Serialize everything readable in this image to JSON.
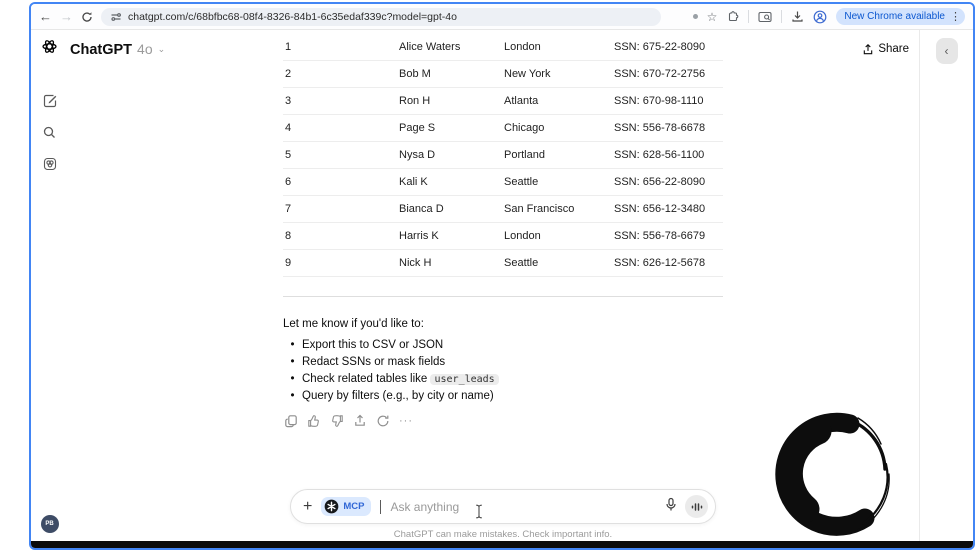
{
  "browser": {
    "url": "chatgpt.com/c/68bfbc68-08f4-8326-84b1-6c35edaf339c?model=gpt-4o",
    "update_badge": "New Chrome available",
    "back_glyph": "←",
    "forward_glyph": "→",
    "star_glyph": "☆",
    "menu_dots": "⋮"
  },
  "header": {
    "app_name": "ChatGPT",
    "model": "4o",
    "model_chevron": "⌄",
    "share_label": "Share"
  },
  "sidebar": {
    "avatar_initials": "PB"
  },
  "right_panel": {
    "collapse_glyph": "‹"
  },
  "table": {
    "rows": [
      {
        "num": "1",
        "name": "Alice Waters",
        "city": "London",
        "ssn": "SSN: 675-22-8090"
      },
      {
        "num": "2",
        "name": "Bob M",
        "city": "New York",
        "ssn": "SSN: 670-72-2756"
      },
      {
        "num": "3",
        "name": "Ron H",
        "city": "Atlanta",
        "ssn": "SSN: 670-98-1110"
      },
      {
        "num": "4",
        "name": "Page S",
        "city": "Chicago",
        "ssn": "SSN: 556-78-6678"
      },
      {
        "num": "5",
        "name": "Nysa D",
        "city": "Portland",
        "ssn": "SSN: 628-56-1100"
      },
      {
        "num": "6",
        "name": "Kali K",
        "city": "Seattle",
        "ssn": "SSN: 656-22-8090"
      },
      {
        "num": "7",
        "name": "Bianca D",
        "city": "San Francisco",
        "ssn": "SSN: 656-12-3480"
      },
      {
        "num": "8",
        "name": "Harris K",
        "city": "London",
        "ssn": "SSN: 556-78-6679"
      },
      {
        "num": "9",
        "name": "Nick H",
        "city": "Seattle",
        "ssn": "SSN: 626-12-5678"
      }
    ]
  },
  "message": {
    "intro": "Let me know if you'd like to:",
    "bullets": [
      {
        "text": "Export this to CSV or JSON"
      },
      {
        "text": "Redact SSNs or mask fields"
      },
      {
        "prefix": "Check related tables like ",
        "code": "user_leads"
      },
      {
        "text": "Query by filters (e.g., by city or name)"
      }
    ],
    "more_glyph": "···"
  },
  "composer": {
    "plus_glyph": "+",
    "mcp_label": "MCP",
    "placeholder": "Ask anything"
  },
  "footer": "ChatGPT can make mistakes. Check important info.",
  "colors": {
    "window_border": "#4285f4",
    "chrome_badge_bg": "#d3e3fd",
    "chrome_badge_text": "#0b57d0",
    "mcp_badge_bg": "#dbe9fe",
    "mcp_badge_text": "#3268d6",
    "avatar_bg": "#3e4c66"
  }
}
